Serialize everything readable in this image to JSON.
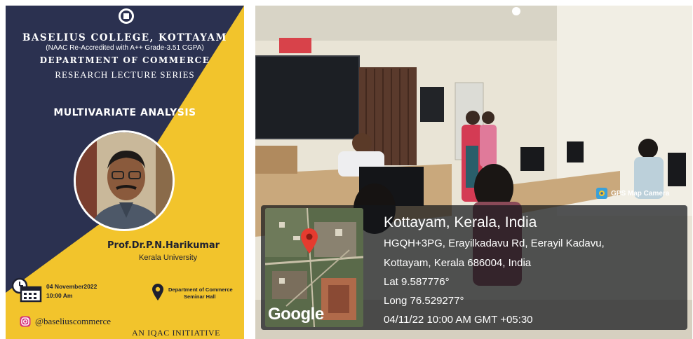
{
  "poster": {
    "college": "BASELIUS COLLEGE, KOTTAYAM",
    "accreditation": "(NAAC Re-Accredited with A++ Grade-3.51 CGPA)",
    "department": "DEPARTMENT OF COMMERCE",
    "series": "RESEARCH LECTURE SERIES",
    "topic": "MULTIVARIATE ANALYSIS",
    "speaker": "Prof.Dr.P.N.Harikumar",
    "affiliation": "Kerala University",
    "date": "04 November2022",
    "time": "10:00 Am",
    "venue_line1": "Department of Commerce",
    "venue_line2": "Seminar Hall",
    "social_handle": "@baseliuscommerce",
    "footer": "AN IQAC INITIATIVE",
    "colors": {
      "navy": "#2b3150",
      "yellow": "#f2c42c"
    },
    "icons": [
      "college-logo-icon",
      "calendar-clock-icon",
      "location-pin-icon",
      "instagram-icon"
    ]
  },
  "photo": {
    "gps_app": "GPS Map Camera",
    "map_brand": "Google",
    "location_title": "Kottayam, Kerala, India",
    "address_line1": "HGQH+3PG, Erayilkadavu Rd, Eerayil Kadavu,",
    "address_line2": "Kottayam, Kerala 686004, India",
    "latitude": "Lat 9.587776°",
    "longitude": "Long 76.529277°",
    "timestamp": "04/11/22 10:00 AM GMT +05:30"
  }
}
